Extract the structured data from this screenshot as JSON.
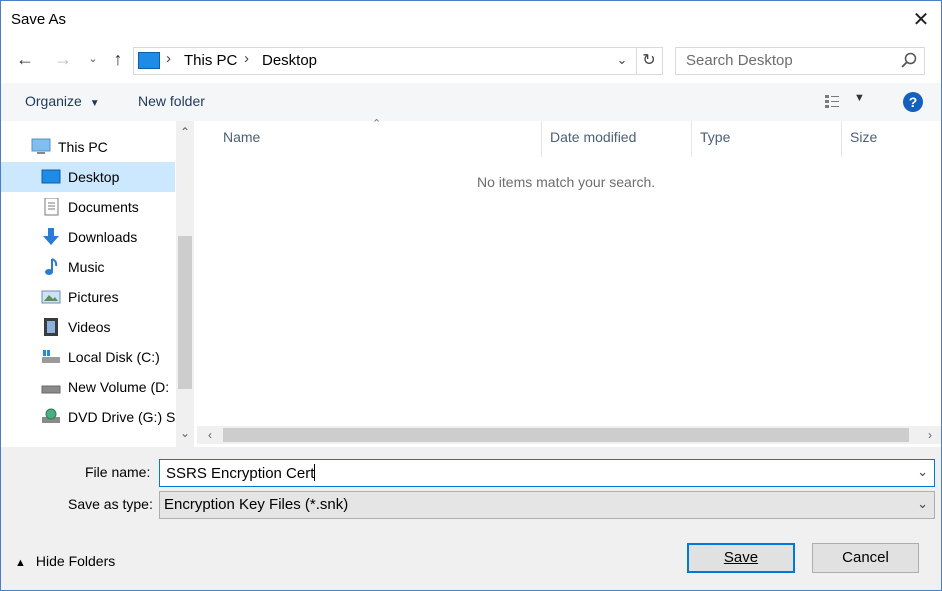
{
  "window": {
    "title": "Save As"
  },
  "address_bar": {
    "crumbs": [
      "This PC",
      "Desktop"
    ]
  },
  "search": {
    "placeholder": "Search Desktop"
  },
  "toolbar": {
    "organize_label": "Organize",
    "new_folder_label": "New folder"
  },
  "nav_pane": {
    "items": [
      {
        "label": "This PC",
        "icon": "computer-icon",
        "selected": false,
        "root": true
      },
      {
        "label": "Desktop",
        "icon": "desktop-icon",
        "selected": true
      },
      {
        "label": "Documents",
        "icon": "documents-icon",
        "selected": false
      },
      {
        "label": "Downloads",
        "icon": "downloads-icon",
        "selected": false
      },
      {
        "label": "Music",
        "icon": "music-icon",
        "selected": false
      },
      {
        "label": "Pictures",
        "icon": "pictures-icon",
        "selected": false
      },
      {
        "label": "Videos",
        "icon": "videos-icon",
        "selected": false
      },
      {
        "label": "Local Disk (C:)",
        "icon": "local-disk-icon",
        "selected": false
      },
      {
        "label": "New Volume (D:",
        "icon": "drive-icon",
        "selected": false
      },
      {
        "label": "DVD Drive (G:) SS",
        "icon": "dvd-drive-icon",
        "selected": false
      }
    ]
  },
  "file_list": {
    "columns": [
      "Name",
      "Date modified",
      "Type",
      "Size"
    ],
    "empty_message": "No items match your search."
  },
  "form": {
    "file_name_label": "File name:",
    "file_name_value": "SSRS Encryption Cert",
    "save_as_type_label": "Save as type:",
    "save_as_type_value": "Encryption Key Files (*.snk)"
  },
  "footer": {
    "hide_folders_label": "Hide Folders",
    "save_label": "Save",
    "cancel_label": "Cancel"
  },
  "colors": {
    "accent": "#0078d7",
    "selection": "#cce8ff",
    "help": "#1560bd"
  }
}
